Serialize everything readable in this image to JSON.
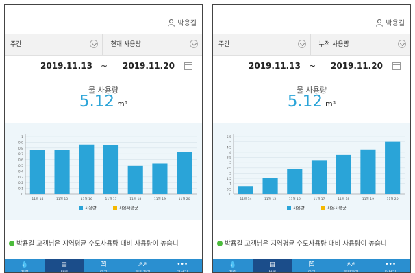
{
  "screens": [
    {
      "user_name": "박용길",
      "period_select": "주간",
      "metric_select": "현재 사용량",
      "date_from": "2019.11.13",
      "date_sep": "~",
      "date_to": "2019.11.20",
      "usage_label": "물 사용량",
      "usage_value": "5.12",
      "usage_unit": "m³",
      "note": "박용길 고객님은 지역평균 수도사용량 대비 사용량이 높습니",
      "chart_data": {
        "type": "bar",
        "categories": [
          "11월 14",
          "11월 15",
          "11월 16",
          "11월 17",
          "11월 18",
          "11월 19",
          "11월 20"
        ],
        "series": [
          {
            "name": "사용량",
            "values": [
              0.77,
              0.77,
              0.86,
              0.85,
              0.49,
              0.53,
              0.73
            ],
            "color": "#2aa4d8"
          }
        ],
        "legend": [
          "사용량",
          "사용자평균"
        ],
        "legend_colors": [
          "#2aa4d8",
          "#f5b800"
        ],
        "y_ticks": [
          "0",
          "0.1",
          "0.2",
          "0.3",
          "0.4",
          "0.5",
          "0.6",
          "0.7",
          "0.8",
          "0.9",
          "1"
        ],
        "ylim": [
          0,
          1
        ],
        "grid": true
      }
    },
    {
      "user_name": "박용길",
      "period_select": "주간",
      "metric_select": "누적 사용량",
      "date_from": "2019.11.13",
      "date_sep": "~",
      "date_to": "2019.11.20",
      "usage_label": "물 사용량",
      "usage_value": "5.12",
      "usage_unit": "m³",
      "note": "박용길 고객님은 지역평균 수도사용량 대비 사용량이 높습니",
      "chart_data": {
        "type": "bar",
        "categories": [
          "11월 14",
          "11월 15",
          "11월 16",
          "11월 17",
          "11월 18",
          "11월 19",
          "11월 20"
        ],
        "series": [
          {
            "name": "사용량",
            "values": [
              0.77,
              1.54,
              2.4,
              3.25,
              3.74,
              4.27,
              5.0
            ],
            "color": "#2aa4d8"
          }
        ],
        "legend": [
          "사용량",
          "사용자평균"
        ],
        "legend_colors": [
          "#2aa4d8",
          "#f5b800"
        ],
        "y_ticks": [
          "0",
          "0.5",
          "1",
          "1.5",
          "2",
          "2.5",
          "3",
          "3.5",
          "4",
          "4.5",
          "5",
          "5.5"
        ],
        "ylim": [
          0,
          5.5
        ],
        "grid": true
      }
    }
  ],
  "tabs": [
    {
      "label": "계량",
      "icon": "water-drop-icon",
      "glyph": "💧",
      "active": false
    },
    {
      "label": "상세",
      "icon": "list-icon",
      "glyph": "▤",
      "active": true
    },
    {
      "label": "요금",
      "icon": "bill-icon",
      "glyph": "凹",
      "active": false
    },
    {
      "label": "회원관리",
      "icon": "people-icon",
      "glyph": "ዶዶ",
      "active": false
    },
    {
      "label": "더보기",
      "icon": "more-icon",
      "glyph": "•••",
      "active": false
    }
  ]
}
